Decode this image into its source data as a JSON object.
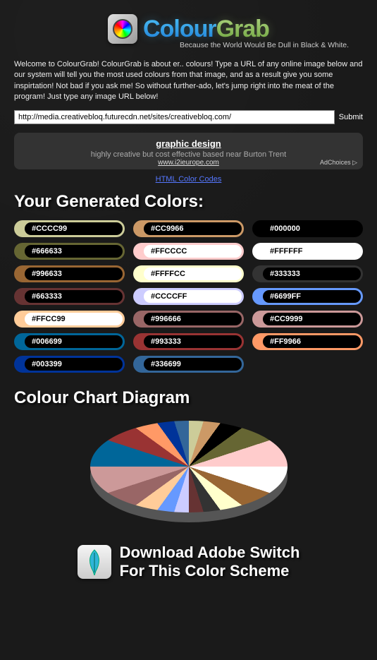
{
  "header": {
    "logo_colour": "Colour",
    "logo_grab": "Grab",
    "tagline": "Because the World Would Be Dull in Black & White."
  },
  "intro": "Welcome to ColourGrab! ColourGrab is about er.. colours! Type a URL of any online image below and our system will tell you the most used colours from that image, and as a result give you some inspirtation! Not bad if you ask me! So without further-ado, let's jump right into the meat of the program! Just type any image URL below!",
  "form": {
    "url_value": "http://media.creativebloq.futurecdn.net/sites/creativebloq.com/",
    "submit_label": "Submit"
  },
  "ad": {
    "title": "graphic design",
    "desc": "highly creative but cost effective based near Burton Trent",
    "url": "www.i2ieurope.com",
    "adchoices": "AdChoices ▷"
  },
  "html_codes_link": "HTML Color Codes",
  "generated_title": "Your Generated Colors:",
  "colors": [
    {
      "hex": "#CCCC99",
      "light": false
    },
    {
      "hex": "#CC9966",
      "light": false
    },
    {
      "hex": "#000000",
      "light": false
    },
    {
      "hex": "#666633",
      "light": false
    },
    {
      "hex": "#FFCCCC",
      "light": true
    },
    {
      "hex": "#FFFFFF",
      "light": true
    },
    {
      "hex": "#996633",
      "light": false
    },
    {
      "hex": "#FFFFCC",
      "light": true
    },
    {
      "hex": "#333333",
      "light": false
    },
    {
      "hex": "#663333",
      "light": false
    },
    {
      "hex": "#CCCCFF",
      "light": true
    },
    {
      "hex": "#6699FF",
      "light": false
    },
    {
      "hex": "#FFCC99",
      "light": true
    },
    {
      "hex": "#996666",
      "light": false
    },
    {
      "hex": "#CC9999",
      "light": false
    },
    {
      "hex": "#006699",
      "light": false
    },
    {
      "hex": "#993333",
      "light": false
    },
    {
      "hex": "#FF9966",
      "light": false
    },
    {
      "hex": "#003399",
      "light": false
    },
    {
      "hex": "#336699",
      "light": false
    }
  ],
  "chart_title": "Colour Chart Diagram",
  "chart_data": {
    "type": "pie",
    "title": "Colour Chart Diagram",
    "categories": [
      "#CCCC99",
      "#CC9966",
      "#000000",
      "#666633",
      "#FFCCCC",
      "#FFFFFF",
      "#996633",
      "#FFFFCC",
      "#333333",
      "#663333",
      "#CCCCFF",
      "#6699FF",
      "#FFCC99",
      "#996666",
      "#CC9999",
      "#006699",
      "#993333",
      "#FF9966",
      "#003399",
      "#336699"
    ],
    "values": [
      5,
      5,
      5,
      5,
      5,
      5,
      5,
      5,
      5,
      5,
      5,
      5,
      5,
      5,
      5,
      5,
      5,
      5,
      5,
      5
    ]
  },
  "download": {
    "line1": "Download Adobe Switch",
    "line2": "For This Color Scheme"
  }
}
